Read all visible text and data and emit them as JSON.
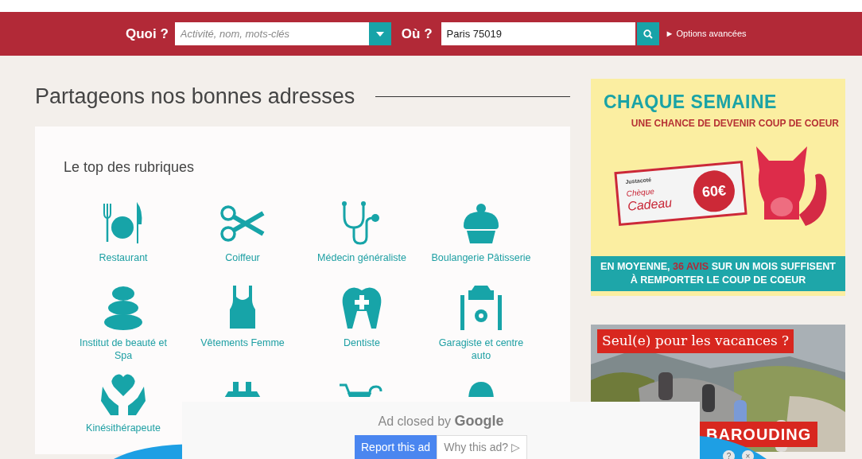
{
  "search_bar": {
    "what_label": "Quoi ?",
    "what_field": {
      "placeholder": "Activité, nom, mots-clés"
    },
    "where_label": "Où ?",
    "where_field": {
      "value": "Paris 75019"
    },
    "advanced_link": {
      "arrow": "►",
      "label": "Options avancées"
    }
  },
  "heading": "Partageons nos bonnes adresses",
  "top_categories": {
    "title": "Le top des rubriques",
    "items": [
      {
        "kind": "labeled",
        "label": "Restaurant"
      },
      {
        "kind": "labeled",
        "label": "Coiffeur"
      },
      {
        "kind": "labeled",
        "label": "Médecin généraliste"
      },
      {
        "kind": "labeled",
        "label": "Boulangerie Pâtisserie"
      },
      {
        "kind": "labeled",
        "label": "Institut de beauté et Spa"
      },
      {
        "kind": "labeled",
        "label": "Vêtements Femme"
      },
      {
        "kind": "labeled",
        "label": "Dentiste"
      },
      {
        "kind": "labeled",
        "label": "Garagiste et centre auto"
      },
      {
        "kind": "labeled",
        "label": "Kinésithérapeute"
      },
      {
        "kind": "covered"
      },
      {
        "kind": "covered"
      },
      {
        "kind": "covered"
      }
    ]
  },
  "ads": [
    {
      "kind": "promo",
      "headline": "CHAQUE SEMAINE",
      "subheadline": "UNE CHANCE DE DEVENIR COUP DE COEUR",
      "cheque_brand": "Justacoté",
      "cheque_title": "Chèque",
      "cheque_subtitle": "Cadeau",
      "amount": "60€",
      "footer": "EN MOYENNE, **36 AVIS** SUR UN MOIS SUFFISENT À REMPORTER LE COUP DE COEUR"
    },
    {
      "headline": "Seul(e) pour les vacances ?",
      "brand": "BAROUDING"
    }
  ],
  "ad_notice": {
    "text": "Ad closed by",
    "brand": "Google",
    "report_button": "Report this ad",
    "why_button": "Why this ad?",
    "why_icon": "▷",
    "help": "?",
    "close": "×"
  }
}
